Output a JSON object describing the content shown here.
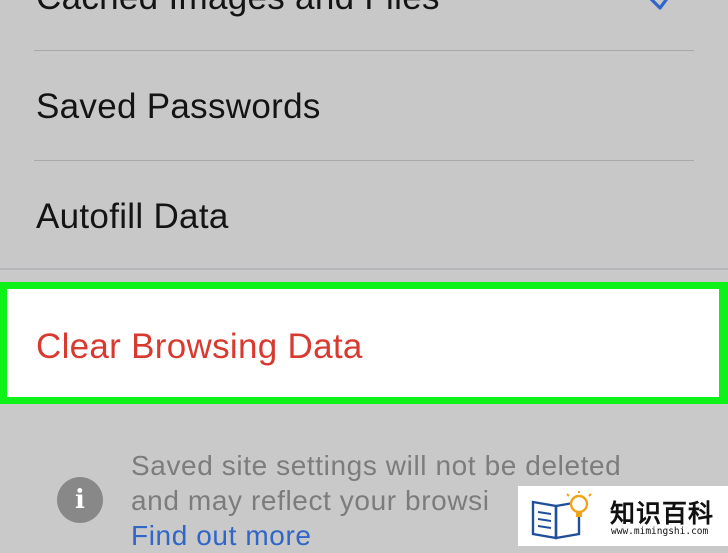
{
  "settings_list": {
    "items": [
      {
        "label": "Cached Images and Files",
        "checked": true
      },
      {
        "label": "Saved Passwords",
        "checked": false
      },
      {
        "label": "Autofill Data",
        "checked": false
      }
    ]
  },
  "clear_action": {
    "label": "Clear Browsing Data"
  },
  "footer": {
    "line1": "Saved site settings will not be deleted",
    "line2": "and may reflect your browsi",
    "link": "Find out more"
  },
  "watermark": {
    "title": "知识百科",
    "url": "www.mimingshi.com"
  },
  "colors": {
    "highlight": "#0ef21a",
    "destructive": "#d93a30",
    "link": "#2f66c8",
    "checkmark": "#2f66c8"
  },
  "icons": [
    "checkmark-icon",
    "info-icon",
    "book-lightbulb-logo"
  ]
}
